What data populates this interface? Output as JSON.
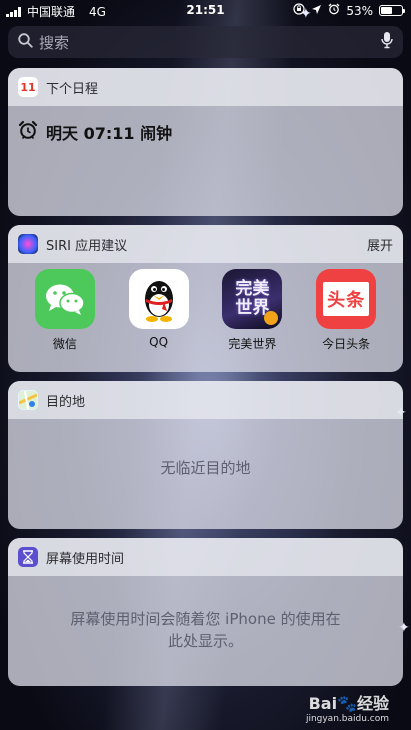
{
  "status_bar": {
    "carrier": "中国联通",
    "network": "4G",
    "time": "21:51",
    "battery": "53%",
    "battery_level": 0.53,
    "icons": [
      "signal-icon",
      "lock-rotation-icon",
      "location-icon",
      "alarm-icon",
      "battery-icon"
    ]
  },
  "search": {
    "placeholder": "搜索",
    "icons": [
      "search-icon",
      "microphone-icon"
    ]
  },
  "widgets": {
    "calendar": {
      "title": "下个日程",
      "date_number": "11",
      "icon": "calendar-icon",
      "alarm_text": "明天 07:11 闹钟",
      "alarm_icon": "alarm-clock-icon"
    },
    "siri": {
      "title": "SIRI 应用建议",
      "action": "展开",
      "icon": "siri-icon",
      "apps": [
        {
          "label": "微信",
          "icon": "wechat-icon",
          "color": "#4cc95a"
        },
        {
          "label": "QQ",
          "icon": "qq-penguin-icon",
          "color": "#ffffff"
        },
        {
          "label": "完美世界",
          "icon": "perfect-world-game-icon",
          "art_text": "完美世界",
          "color": "#2a2350"
        },
        {
          "label": "今日头条",
          "icon": "toutiao-icon",
          "art_text": "头条",
          "color": "#f04142"
        }
      ]
    },
    "destinations": {
      "title": "目的地",
      "icon": "maps-icon",
      "message": "无临近目的地"
    },
    "screen_time": {
      "title": "屏幕使用时间",
      "icon": "hourglass-icon",
      "message_line1": "屏幕使用时间会随着您 iPhone 的使用在",
      "message_line2": "此处显示。"
    }
  },
  "watermark": {
    "brand": "Bai",
    "brand_suffix": "经验",
    "url": "jingyan.baidu.com"
  }
}
